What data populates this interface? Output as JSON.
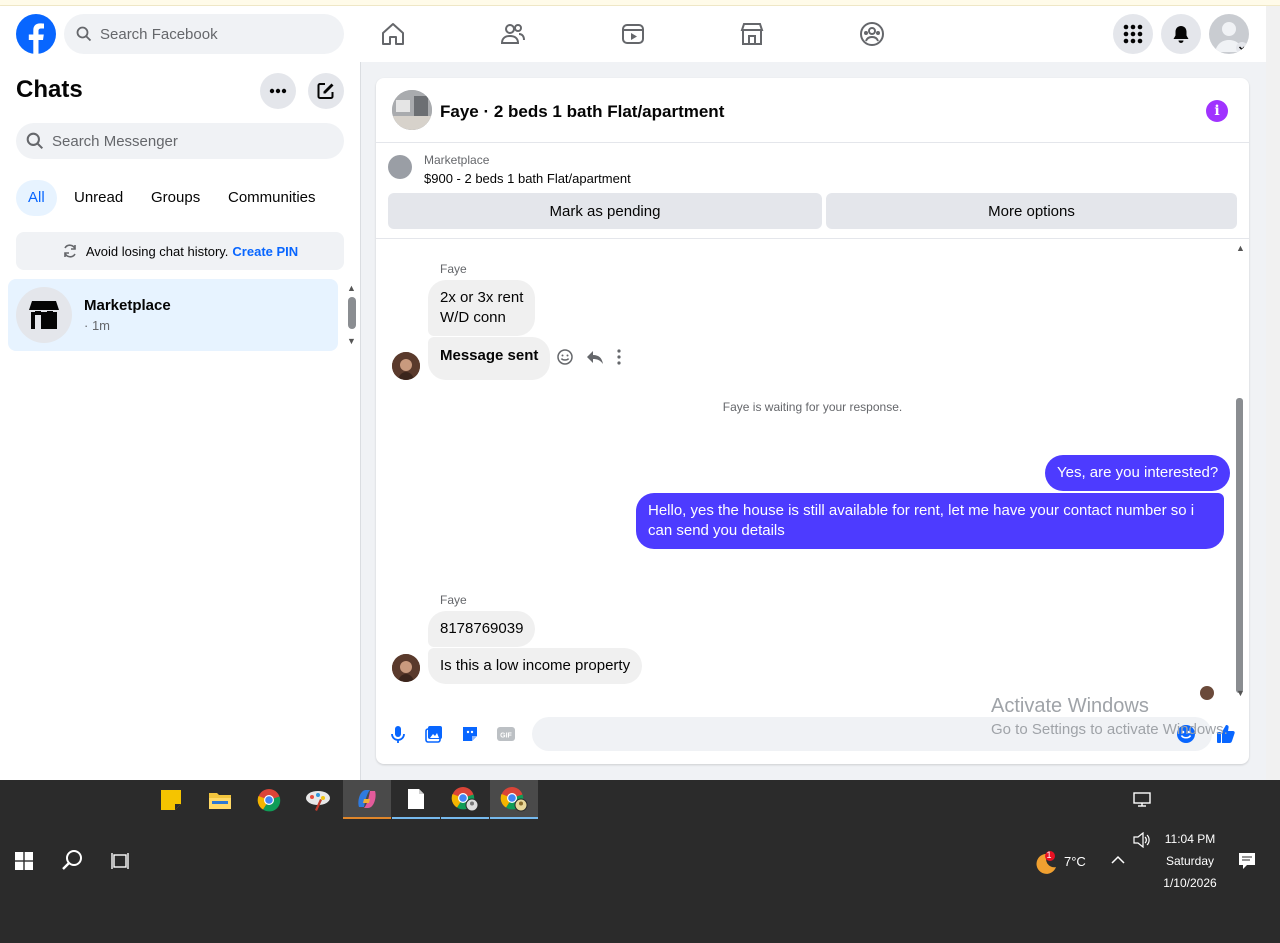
{
  "facebook": {
    "search_placeholder": "Search Facebook",
    "nav_icons": [
      "home-icon",
      "friends-icon",
      "watch-icon",
      "marketplace-icon",
      "groups-icon"
    ],
    "right_icons": [
      "menu-grid-icon",
      "bell-icon",
      "profile-avatar"
    ]
  },
  "sidebar": {
    "title": "Chats",
    "search_placeholder": "Search Messenger",
    "filters": [
      "All",
      "Unread",
      "Groups",
      "Communities"
    ],
    "pin_text": "Avoid losing chat history.",
    "pin_link": "Create PIN",
    "chat": {
      "name": "Marketplace",
      "time": "· 1m"
    }
  },
  "conversation": {
    "title": "Faye · 2 beds 1 bath Flat/apartment",
    "marketplace_label": "Marketplace",
    "listing": "$900 - 2 beds 1 bath Flat/apartment",
    "mark_pending": "Mark as pending",
    "more_options": "More options",
    "sender1": "Faye",
    "msg1_line1": "2x or 3x rent",
    "msg1_line2": "W/D conn",
    "msg2": "Message sent",
    "status": "Faye is waiting for your response.",
    "me1": "Yes, are you interested?",
    "me2_line1": "Hello, yes the house is still available for rent, let me have your contact number so i",
    "me2_line2": "can send you details",
    "sender2": "Faye",
    "msg3": "8178769039",
    "msg4": "Is this a low income property"
  },
  "watermark": {
    "title": "Activate Windows",
    "sub": "Go to Settings to activate Windows."
  },
  "taskbar": {
    "weather_temp": "7°C",
    "weather_badge": "1",
    "time": "11:04 PM",
    "day": "Saturday",
    "date": "1/10/2026"
  },
  "colors": {
    "fb_blue": "#0866ff",
    "my_bubble": "#4d3bff",
    "info": "#a033ff"
  }
}
